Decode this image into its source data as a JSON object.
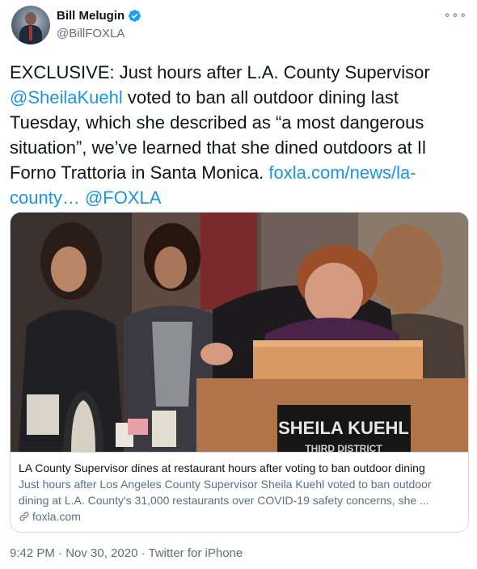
{
  "author": {
    "display_name": "Bill Melugin",
    "handle": "@BillFOXLA"
  },
  "tweet": {
    "text_prefix": "EXCLUSIVE: Just hours after L.A. County Supervisor ",
    "mention_1": "@SheilaKuehl",
    "text_middle": " voted to ban all outdoor dining last Tuesday, which she described as “a most dangerous situation”, we’ve learned that she dined outdoors at Il Forno Trattoria in Santa Monica. ",
    "link": "foxla.com/news/la-county…",
    "mention_2": "@FOXLA"
  },
  "card": {
    "placard_name": "SHEILA KUEHL",
    "placard_subtitle": "THIRD DISTRICT",
    "title": "LA County Supervisor dines at restaurant hours after voting to ban outdoor dining",
    "description": "Just hours after Los Angeles County Supervisor Sheila Kuehl voted to ban outdoor dining at L.A. County's 31,000 restaurants over COVID-19 safety concerns, she ...",
    "domain": "foxla.com"
  },
  "meta": {
    "timestamp": "9:42 PM · Nov 30, 2020",
    "separator": " · ",
    "source": "Twitter for iPhone"
  },
  "colors": {
    "link": "#1b95e0",
    "secondary_text": "#5b7083",
    "verified": "#1da1f2"
  }
}
